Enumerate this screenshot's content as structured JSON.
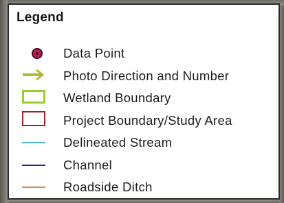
{
  "legend": {
    "title": "Legend",
    "items": [
      {
        "label": "Data Point",
        "symbol": "data-point-icon",
        "color": "#c2185b"
      },
      {
        "label": "Photo Direction and Number",
        "symbol": "photo-direction-arrow-icon",
        "color": "#b5b832"
      },
      {
        "label": "Wetland Boundary",
        "symbol": "wetland-boundary-icon",
        "color": "#9acd32"
      },
      {
        "label": "Project Boundary/Study Area",
        "symbol": "project-boundary-icon",
        "color": "#a0202c"
      },
      {
        "label": "Delineated Stream",
        "symbol": "delineated-stream-line-icon",
        "color": "#4fb3c0"
      },
      {
        "label": "Channel",
        "symbol": "channel-line-icon",
        "color": "#2323a8"
      },
      {
        "label": "Roadside Ditch",
        "symbol": "roadside-ditch-line-icon",
        "color": "#e08a3c"
      }
    ]
  }
}
